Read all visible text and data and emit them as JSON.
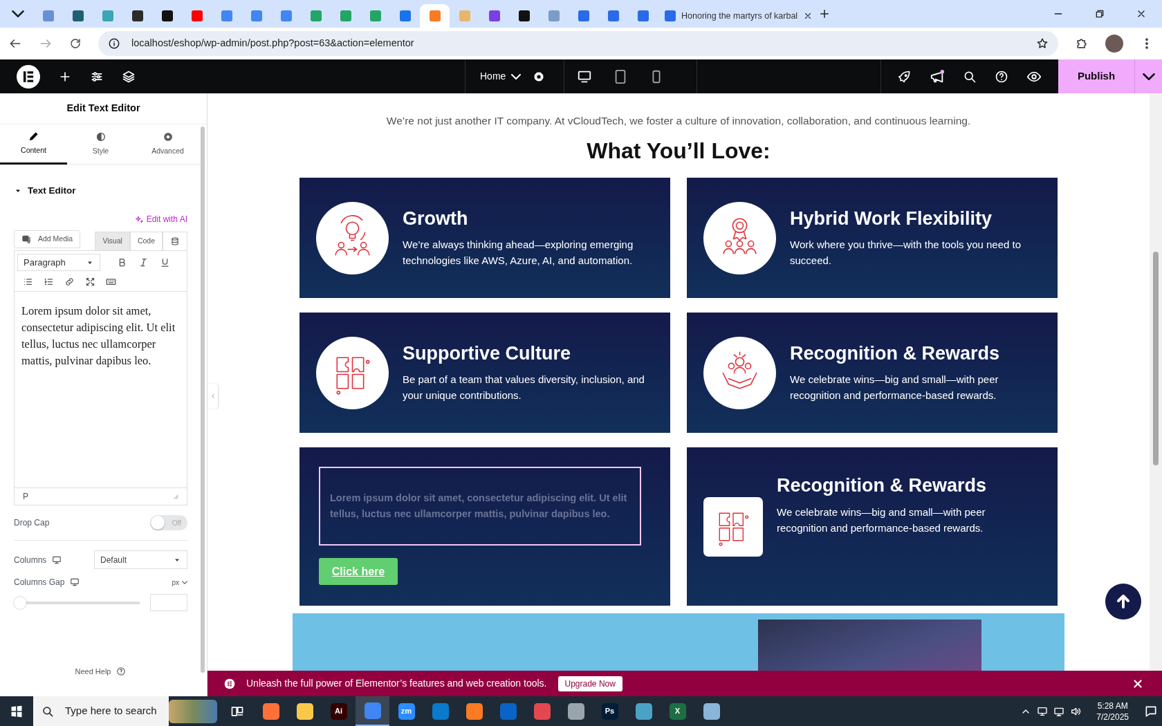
{
  "browser": {
    "tabs": [
      {
        "color": "#6b8fd6",
        "selected": false
      },
      {
        "color": "#1e5f74",
        "selected": false
      },
      {
        "color": "#3aa5b5",
        "selected": false
      },
      {
        "color": "#2b2b2b",
        "selected": false
      },
      {
        "color": "#111111",
        "selected": false
      },
      {
        "color": "#ff0000",
        "selected": false
      },
      {
        "color": "#4285f4",
        "selected": false
      },
      {
        "color": "#4285f4",
        "selected": false
      },
      {
        "color": "#4285f4",
        "selected": false
      },
      {
        "color": "#23a566",
        "selected": false
      },
      {
        "color": "#23a566",
        "selected": false
      },
      {
        "color": "#23a566",
        "selected": false
      },
      {
        "color": "#1a73e8",
        "selected": false
      },
      {
        "color": "#fb7a24",
        "selected": true
      },
      {
        "color": "#e8b66a",
        "selected": false
      },
      {
        "color": "#7b3fe4",
        "selected": false
      },
      {
        "color": "#111111",
        "selected": false
      },
      {
        "color": "#7a9cc6",
        "selected": false
      },
      {
        "color": "#2a6ae8",
        "selected": false
      },
      {
        "color": "#2a6ae8",
        "selected": false
      },
      {
        "color": "#2a6ae8",
        "selected": false
      },
      {
        "color": "#2a6ae8",
        "selected": false,
        "title": "Honoring the martyrs of karbal"
      }
    ],
    "address": "localhost/eshop/wp-admin/post.php?post=63&action=elementor"
  },
  "editor_bar": {
    "page": "Home",
    "devices": [
      {
        "kind": "desktop",
        "selected": true
      },
      {
        "kind": "tablet",
        "selected": false
      },
      {
        "kind": "mobile",
        "selected": false
      }
    ],
    "notification": true,
    "publish": "Publish"
  },
  "panel": {
    "title": "Edit Text Editor",
    "tabs": [
      {
        "label": "Content",
        "kind": "content",
        "selected": true
      },
      {
        "label": "Style",
        "kind": "style",
        "selected": false
      },
      {
        "label": "Advanced",
        "kind": "advanced",
        "selected": false
      }
    ],
    "section": {
      "title": "Text Editor",
      "expanded": true
    },
    "ai_link": "Edit with AI",
    "add_media": "Add Media",
    "editor_tabs": [
      {
        "label": "Visual",
        "selected": true
      },
      {
        "label": "Code",
        "selected": false
      }
    ],
    "format": "Paragraph",
    "content": "Lorem ipsum dolor sit amet, consectetur adipiscing elit. Ut elit tellus, luctus nec ullamcorper mattis, pulvinar dapibus leo.",
    "path": "P",
    "drop_cap": {
      "label": "Drop Cap",
      "on": false,
      "state_label": "Off"
    },
    "columns": {
      "label": "Columns",
      "value": "Default"
    },
    "columns_gap": {
      "label": "Columns Gap",
      "unit": "px",
      "level": 0
    },
    "help": "Need Help"
  },
  "page": {
    "intro": "We’re not just another IT company. At vCloudTech, we foster a culture of innovation, collaboration, and continuous learning.",
    "heading": "What You’ll Love:",
    "cards": [
      {
        "kind": "feature",
        "title": "Growth",
        "text": "We’re always thinking ahead—exploring emerging technologies like AWS, Azure, AI, and automation."
      },
      {
        "kind": "feature",
        "title": "Hybrid Work Flexibility",
        "text": "Work where you thrive—with the tools you need to succeed."
      },
      {
        "kind": "feature",
        "title": "Supportive Culture",
        "text": "Be part of a team that values diversity, inclusion, and your unique contributions."
      },
      {
        "kind": "feature",
        "title": "Recognition & Rewards",
        "text": "We celebrate wins—big and small—with peer recognition and performance-based rewards."
      },
      {
        "kind": "editing",
        "text": "Lorem ipsum dolor sit amet, consectetur adipiscing elit. Ut elit tellus, luctus nec ullamcorper mattis, pulvinar dapibus leo.",
        "button": "Click here"
      },
      {
        "kind": "boxed",
        "title": "Recognition & Rewards",
        "text": "We celebrate wins—big and small—with peer recognition and performance-based rewards."
      }
    ]
  },
  "promo": {
    "text": "Unleash the full power of Elementor’s features and web creation tools.",
    "button": "Upgrade Now"
  },
  "taskbar": {
    "search_placeholder": "Type here to search",
    "apps": [
      {
        "color": "#ff7139",
        "selected": false
      },
      {
        "color": "#f8c84b",
        "selected": false
      },
      {
        "color": "#330000",
        "selected": false,
        "label": "Ai"
      },
      {
        "color": "#4285f4",
        "selected": true
      },
      {
        "color": "#2d8cff",
        "selected": false,
        "label": "zm"
      },
      {
        "color": "#0a7acc",
        "selected": false
      },
      {
        "color": "#fb7a24",
        "selected": false
      },
      {
        "color": "#0a64c8",
        "selected": false
      },
      {
        "color": "#e34850",
        "selected": false
      },
      {
        "color": "#9aa4ad",
        "selected": false
      },
      {
        "color": "#001e36",
        "selected": false,
        "label": "Ps"
      },
      {
        "color": "#4aa3c4",
        "selected": false
      },
      {
        "color": "#1d6f42",
        "selected": false,
        "label": "X"
      },
      {
        "color": "#8ab4d8",
        "selected": false
      }
    ],
    "time": "5:28 AM",
    "date": "7/2/2025"
  }
}
